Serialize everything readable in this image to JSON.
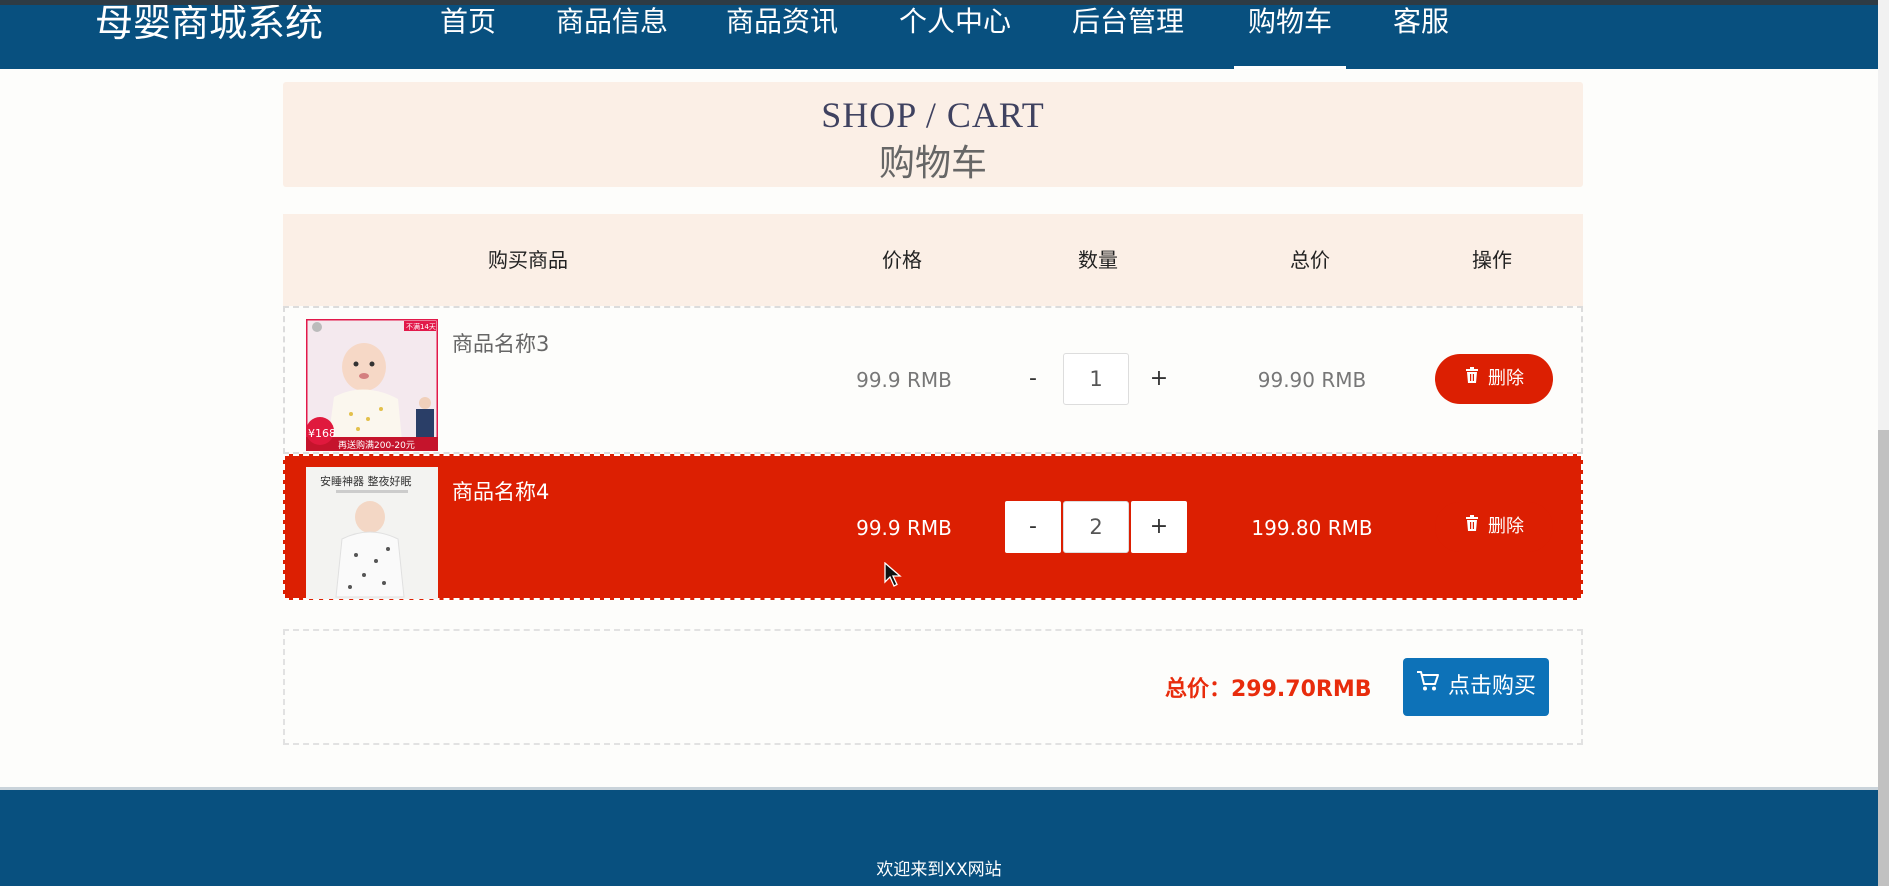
{
  "nav": {
    "brand": "母婴商城系统",
    "items": [
      {
        "label": "首页"
      },
      {
        "label": "商品信息"
      },
      {
        "label": "商品资讯"
      },
      {
        "label": "个人中心"
      },
      {
        "label": "后台管理"
      },
      {
        "label": "购物车",
        "active": true
      },
      {
        "label": "客服"
      }
    ]
  },
  "banner": {
    "title_en": "SHOP / CART",
    "title_cn": "购物车"
  },
  "table": {
    "headers": [
      "购买商品",
      "价格",
      "数量",
      "总价",
      "操作"
    ],
    "rows": [
      {
        "name": "商品名称3",
        "price": "99.9 RMB",
        "qty": "1",
        "subtotal": "99.90 RMB",
        "delete_label": "删除",
        "minus": "-",
        "plus": "+",
        "image_icon": "baby-product-photo",
        "image_text": {
          "top_tag": "不满14天",
          "badge": "¥168",
          "strip": "再送购满200-20元"
        }
      },
      {
        "name": "商品名称4",
        "price": "99.9 RMB",
        "qty": "2",
        "subtotal": "199.80 RMB",
        "delete_label": "删除",
        "minus": "-",
        "plus": "+",
        "image_icon": "baby-sleeping-bag-photo",
        "image_text": {
          "headline": "安睡神器 整夜好眠"
        }
      }
    ]
  },
  "summary": {
    "total_label": "总价：299.70RMB",
    "buy_label": "点击购买",
    "cart_icon": "cart-icon"
  },
  "footer": {
    "text": "欢迎来到XX网站"
  },
  "colors": {
    "nav_bg": "#08507f",
    "banner_bg": "#fbefe6",
    "highlight_row": "#dc1f02",
    "delete_btn": "#dc1f02",
    "buy_btn": "#0d72b8",
    "total_text": "#e82c0c"
  }
}
